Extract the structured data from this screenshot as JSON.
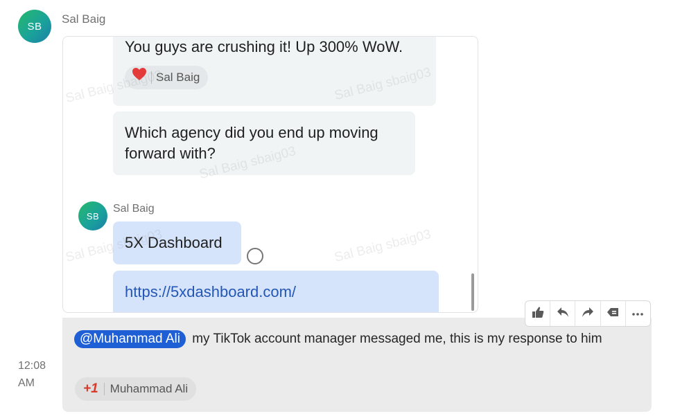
{
  "sender": {
    "name": "Sal Baig",
    "initials": "SB"
  },
  "attachment": {
    "bubble1_text": "You guys are crushing it! Up 300% WoW.",
    "bubble1_reaction": {
      "emoji": "heart-emoji",
      "user": "Sal Baig"
    },
    "bubble2_text": "Which agency did you end up moving forward with?",
    "inner_sender": {
      "name": "Sal Baig",
      "initials": "SB"
    },
    "bubble3_text": "5X Dashboard",
    "bubble4_link": "https://5xdashboard.com/",
    "watermark": "Sal Baig sbaig03"
  },
  "message": {
    "mention": "@Muhammad Ali",
    "text": "my TikTok account manager messaged me, this is my response to him",
    "reaction": {
      "emoji": "+1",
      "user": "Muhammad  Ali"
    }
  },
  "timestamp": {
    "time": "12:08",
    "period": "AM"
  },
  "toolbar": {
    "icons": [
      "thumbs-up-icon",
      "reply-icon",
      "forward-icon",
      "quote-icon",
      "more-icon"
    ]
  },
  "colors": {
    "mention_bg": "#1f5fd6",
    "link": "#2457b3",
    "blue_bubble": "#d5e3fb"
  }
}
